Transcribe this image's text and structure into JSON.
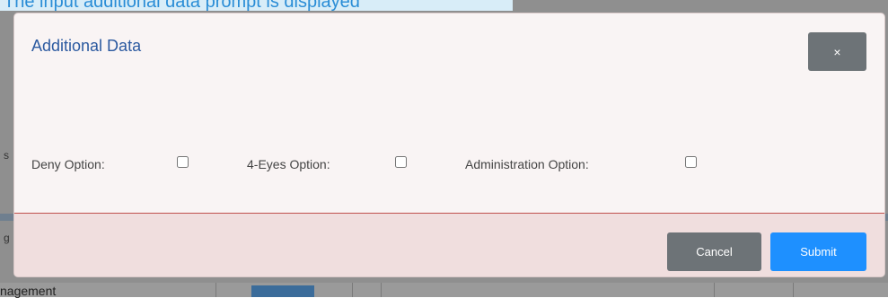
{
  "caption": {
    "text": "The input additional data prompt is displayed"
  },
  "background": {
    "left_fragment_1": "s",
    "left_fragment_2": "g",
    "bottom_text": "nagement"
  },
  "modal": {
    "title": "Additional Data",
    "close_label": "×",
    "options": [
      {
        "label": "Deny Option:",
        "checked": false
      },
      {
        "label": "4-Eyes Option:",
        "checked": false
      },
      {
        "label": "Administration Option:",
        "checked": false
      }
    ],
    "footer": {
      "cancel_label": "Cancel",
      "submit_label": "Submit"
    }
  },
  "colors": {
    "title": "#2c5aa0",
    "submit": "#1e90ff",
    "secondary_button": "#6d7377",
    "footer_border": "#c0504d"
  }
}
